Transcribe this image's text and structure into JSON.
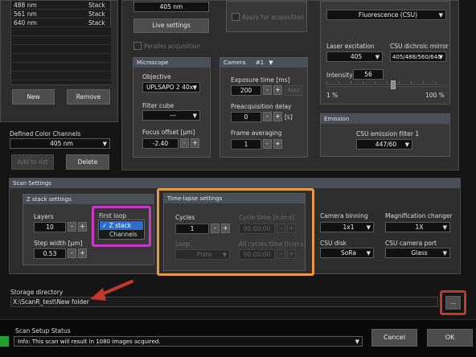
{
  "channel_list": [
    {
      "name": "488 nm",
      "mode": "Stack"
    },
    {
      "name": "561 nm",
      "mode": "Stack"
    },
    {
      "name": "640 nm",
      "mode": "Stack"
    }
  ],
  "left": {
    "new_label": "New",
    "remove_label": "Remove",
    "defined_color_channels_label": "Defined Color Channels",
    "defined_color_channels_value": "405 nm",
    "add_to_list_label": "Add to list",
    "delete_label": "Delete"
  },
  "top_mid": {
    "channel_value": "405 nm",
    "live_settings_label": "Live settings",
    "parallel_acquisition_label": "Parallel acquisition",
    "apply_for_acquisition_label": "Apply for acquisition"
  },
  "microscope": {
    "title": "Microscope",
    "objective_label": "Objective",
    "objective_value": "UPLSAPO 2 40x",
    "filter_cube_label": "Filter cube",
    "filter_cube_value": "---",
    "focus_offset_label": "Focus offset [µm]",
    "focus_offset_value": "-2.40"
  },
  "camera": {
    "title": "Camera",
    "number": "#1",
    "exposure_label": "Exposure time [ms]",
    "exposure_value": "200",
    "auto_label": "Auto",
    "preacq_label": "Preacquisition delay",
    "preacq_value": "0",
    "preacq_unit": "[s]",
    "averaging_label": "Frame averaging",
    "averaging_value": "1"
  },
  "fluorescence": {
    "mode_value": "Fluorescence (CSU)",
    "laser_label": "Laser excitation",
    "laser_value": "405",
    "dichroic_label": "CSU dichroic mirror",
    "dichroic_value": "405/488/560/640",
    "intensity_label": "Intensity",
    "intensity_value": "56",
    "intensity_level": 0.56,
    "min_label": "1 %",
    "max_label": "100 %"
  },
  "emission": {
    "title": "Emission",
    "filter_label": "CSU emission filter 1",
    "filter_value": "447/60"
  },
  "scan_settings": {
    "title": "Scan Settings",
    "zstack": {
      "title": "Z stack settings",
      "layers_label": "Layers",
      "layers_value": "10",
      "step_label": "Step width [µm]",
      "step_value": "0.53"
    },
    "first_loop": {
      "label": "First loop",
      "options": [
        "✓ Z stack",
        "Channels"
      ]
    },
    "timelapse": {
      "title": "Time-lapse settings",
      "cycles_label": "Cycles",
      "cycles_value": "1",
      "cycle_time_label": "Cycle time [h:m:s]",
      "cycle_time_value": "00:00:00",
      "loop_label": "Loop",
      "loop_value": "Plate",
      "all_cycles_label": "All cycles time [h:m:s]",
      "all_cycles_value": "00:00:00"
    },
    "camera_binning_label": "Camera binning",
    "camera_binning_value": "1x1",
    "mag_changer_label": "Magnification changer",
    "mag_changer_value": "1X",
    "csu_disk_label": "CSU disk",
    "csu_disk_value": "SoRa",
    "csu_port_label": "CSU camera port",
    "csu_port_value": "Glass"
  },
  "storage": {
    "label": "Storage directory",
    "path": "X:\\ScanR_test\\New folder",
    "browse_label": "..."
  },
  "status": {
    "title": "Scan Setup Status",
    "message": "Info: This scan will result in 1080 images acquired."
  },
  "footer": {
    "cancel_label": "Cancel",
    "ok_label": "OK"
  },
  "colors": {
    "annotation_magenta": "#c83cc4",
    "annotation_orange": "#e89a3c",
    "annotation_red": "#c0392b",
    "status_green": "#1fa12f",
    "selection_blue": "#2a6fd0"
  },
  "icons": [
    "chevron-down-icon",
    "check-icon",
    "arrow-annotation-icon"
  ]
}
